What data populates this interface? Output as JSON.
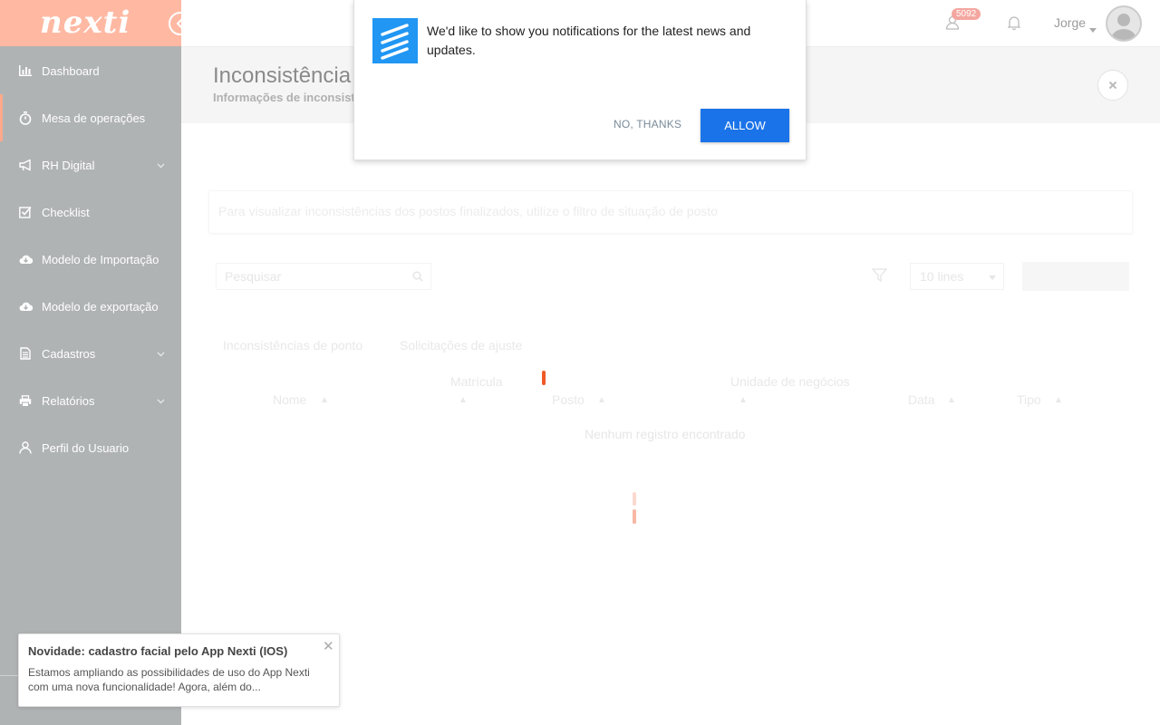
{
  "brand": {
    "logo_text": "nexti",
    "logo_color": "#ffffff",
    "accent": "#ffb9a3"
  },
  "sidebar": {
    "collapse_icon": "chevron-left-icon",
    "items": [
      {
        "label": "Dashboard",
        "icon": "bar-chart-icon",
        "expandable": false,
        "active": false
      },
      {
        "label": "Mesa de operações",
        "icon": "stopwatch-icon",
        "expandable": false,
        "active": true
      },
      {
        "label": "RH Digital",
        "icon": "megaphone-icon",
        "expandable": true,
        "active": false
      },
      {
        "label": "Checklist",
        "icon": "checkbox-icon",
        "expandable": false,
        "active": false
      },
      {
        "label": "Modelo de Importação",
        "icon": "cloud-download-icon",
        "expandable": false,
        "active": false
      },
      {
        "label": "Modelo de exportação",
        "icon": "cloud-download-icon",
        "expandable": false,
        "active": false
      },
      {
        "label": "Cadastros",
        "icon": "document-icon",
        "expandable": true,
        "active": false
      },
      {
        "label": "Relatórios",
        "icon": "printer-icon",
        "expandable": true,
        "active": false
      },
      {
        "label": "Perfil do Usuario",
        "icon": "user-icon",
        "expandable": false,
        "active": false
      }
    ]
  },
  "topbar": {
    "badge_count": "5092",
    "user_name": "Jorge"
  },
  "header": {
    "title": "Inconsistência",
    "subtitle": "Informações de inconsist"
  },
  "content": {
    "info_text": "Para visualizar inconsistências dos postos finalizados, utilize o filtro de situação de posto",
    "search_placeholder": "Pesquisar",
    "lines_value": "10 lines",
    "tabs": [
      "Inconsistências de ponto",
      "Solicitações de ajuste"
    ],
    "columns": [
      "Nome",
      "Matrícula",
      "Posto",
      "Unidade de negócios",
      "Data",
      "Tipo"
    ],
    "empty_message": "Nenhum registro encontrado"
  },
  "notification_prompt": {
    "message": "We'd like to show you notifications for the latest news and updates.",
    "decline_label": "NO, THANKS",
    "allow_label": "ALLOW",
    "allow_color": "#1a73e8",
    "icon_color": "#2196f3"
  },
  "toast": {
    "title": "Novidade: cadastro facial pelo App Nexti (IOS)",
    "body": "Estamos ampliando as possibilidades de uso do App Nexti com uma nova funcionalidade! Agora, além do..."
  }
}
